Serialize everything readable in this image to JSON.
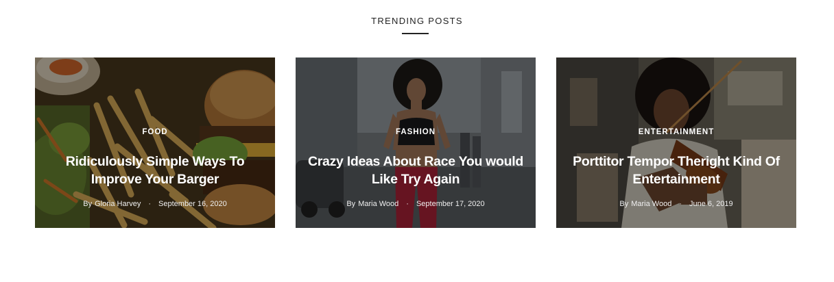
{
  "section": {
    "title": "TRENDING POSTS"
  },
  "posts": [
    {
      "category": "FOOD",
      "title": "Ridiculously Simple Ways To Improve Your Barger",
      "by_label": "By",
      "author": "Gloria Harvey",
      "separator": "·",
      "date": "September 16, 2020",
      "image": "burger-and-fries-photo"
    },
    {
      "category": "FASHION",
      "title": "Crazy Ideas About Race You would Like Try Again",
      "by_label": "By",
      "author": "Maria Wood",
      "separator": "·",
      "date": "September 17, 2020",
      "image": "woman-running-street-photo"
    },
    {
      "category": "ENTERTAINMENT",
      "title": "Porttitor Tempor Theright Kind Of Entertainment",
      "by_label": "By",
      "author": "Maria Wood",
      "separator": "·",
      "date": "June 6, 2019",
      "image": "violin-player-street-photo"
    }
  ]
}
